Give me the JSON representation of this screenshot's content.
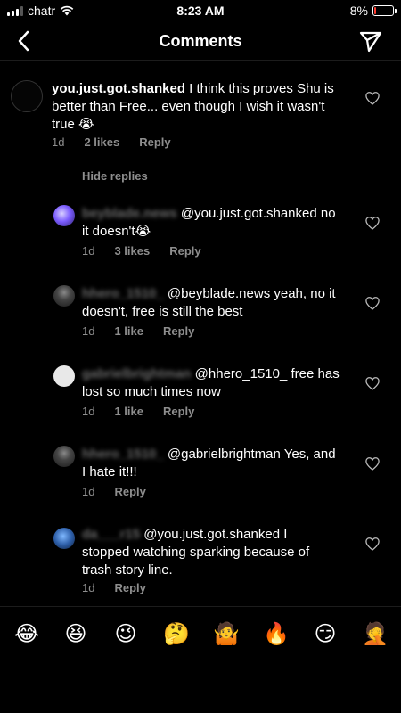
{
  "status": {
    "carrier": "chatr",
    "time": "8:23 AM",
    "battery_label": "8%",
    "battery_level": 0.08
  },
  "nav": {
    "title": "Comments"
  },
  "parent_comment": {
    "username": "you.just.got.shanked",
    "text_line1": " I think this proves Shu is",
    "text_line2": "better than Free... even though I wish it wasn't",
    "text_line3": "true 😭",
    "time": "1d",
    "likes": "2 likes",
    "reply": "Reply"
  },
  "hide_replies": "Hide replies",
  "replies": [
    {
      "username": "beyblade.news",
      "line1": " @you.just.got.shanked no",
      "line2": "it doesn't😭",
      "time": "1d",
      "likes": "3 likes",
      "reply": "Reply"
    },
    {
      "username": "hhero_1510_",
      "line1": " @beyblade.news yeah, no it",
      "line2": "doesn't, free is still the best",
      "time": "1d",
      "likes": "1 like",
      "reply": "Reply"
    },
    {
      "username": "gabrielbrightman",
      "line1": " @hhero_1510_ free has",
      "line2": "lost so much times now",
      "time": "1d",
      "likes": "1 like",
      "reply": "Reply"
    },
    {
      "username": "hhero_1510_",
      "line1": " @gabrielbrightman Yes, and",
      "line2": "I hate it!!!",
      "time": "1d",
      "likes": "",
      "reply": "Reply"
    },
    {
      "username": "da___r15",
      "line1": " @you.just.got.shanked I",
      "line2": "stopped watching sparking because of",
      "line3": "trash story line.",
      "time": "1d",
      "likes": "",
      "reply": "Reply"
    }
  ],
  "emojis": [
    "😂",
    "😆",
    "😉",
    "🤔",
    "🤷",
    "🔥",
    "😏",
    "🤦"
  ]
}
